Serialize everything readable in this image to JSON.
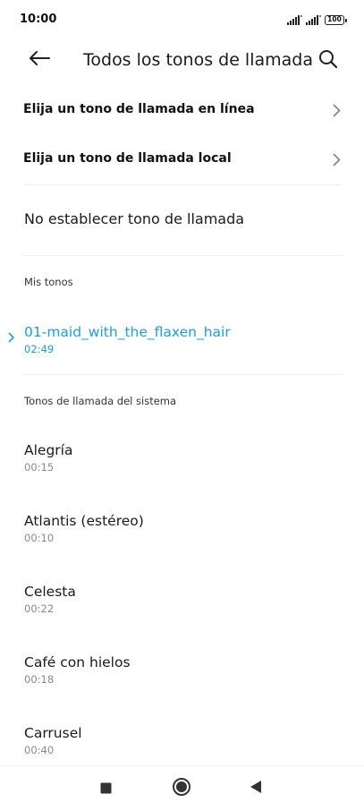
{
  "status_bar": {
    "time": "10:00",
    "battery": "100",
    "icons": [
      "signal-icon",
      "signal-icon",
      "battery-icon"
    ]
  },
  "toolbar": {
    "title": "Todos los tonos de llamada",
    "icons": [
      "back-arrow-icon",
      "search-icon"
    ]
  },
  "nav_rows": [
    {
      "label": "Elija un tono de llamada en línea"
    },
    {
      "label": "Elija un tono de llamada local"
    }
  ],
  "no_ringtone_label": "No establecer tono de llamada",
  "sections": {
    "my_tones": {
      "header": "Mis tonos",
      "items": [
        {
          "name": "01-maid_with_the_flaxen_hair",
          "duration": "02:49",
          "selected": true
        }
      ]
    },
    "system": {
      "header": "Tonos de llamada del sistema",
      "items": [
        {
          "name": "Alegría",
          "duration": "00:15"
        },
        {
          "name": "Atlantis (estéreo)",
          "duration": "00:10"
        },
        {
          "name": "Celesta",
          "duration": "00:22"
        },
        {
          "name": "Café con hielos",
          "duration": "00:18"
        },
        {
          "name": "Carrusel",
          "duration": "00:40"
        }
      ]
    }
  },
  "colors": {
    "accent": "#1ea0d8",
    "text": "#1a1a1a",
    "secondary_text": "#8a8a8a"
  },
  "nav_bar": {
    "icons": [
      "recents-square-icon",
      "home-circle-icon",
      "back-triangle-icon"
    ]
  }
}
